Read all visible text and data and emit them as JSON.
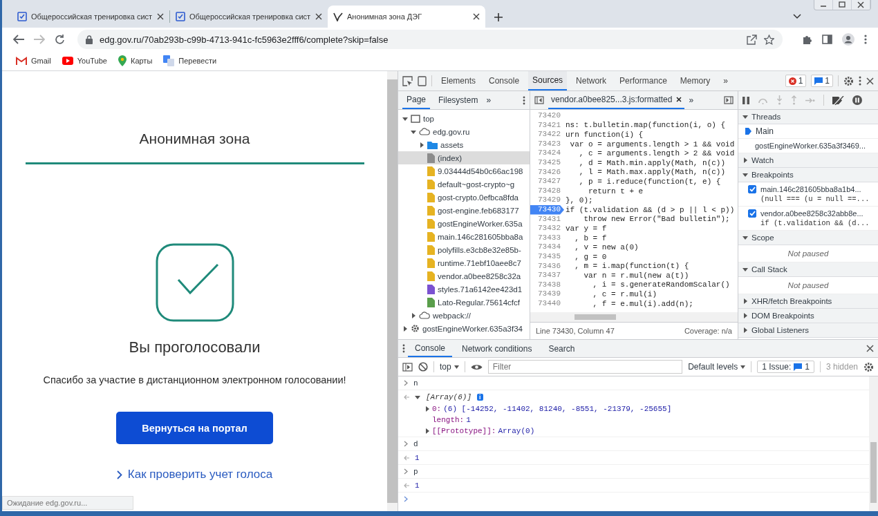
{
  "browser": {
    "tabs": [
      {
        "title": "Общероссийская тренировка сист",
        "kind": "ballot",
        "selected": false
      },
      {
        "title": "Общероссийская тренировка сист",
        "kind": "ballot",
        "selected": false
      },
      {
        "title": "Анонимная зона ДЭГ",
        "kind": "deg",
        "selected": true
      }
    ],
    "address": "edg.gov.ru/70ab293b-c99b-4713-941c-fc5963e2fff6/complete?skip=false",
    "bookmarks": [
      {
        "label": "Gmail",
        "kind": "gmail"
      },
      {
        "label": "YouTube",
        "kind": "youtube"
      },
      {
        "label": "Карты",
        "kind": "maps"
      },
      {
        "label": "Перевести",
        "kind": "translate"
      }
    ]
  },
  "page": {
    "title": "Анонимная зона",
    "heading": "Вы проголосовали",
    "message": "Спасибо за участие в дистанционном электронном голосовании!",
    "button": "Вернуться на портал",
    "link": "Как проверить учет голоса",
    "status": "Ожидание edg.gov.ru..."
  },
  "devtools": {
    "panels": [
      {
        "label": "Elements",
        "selected": false
      },
      {
        "label": "Console",
        "selected": false
      },
      {
        "label": "Sources",
        "selected": true
      },
      {
        "label": "Network",
        "selected": false
      },
      {
        "label": "Performance",
        "selected": false
      },
      {
        "label": "Memory",
        "selected": false
      }
    ],
    "more": "»",
    "errors": "1",
    "messages": "1",
    "navigator": {
      "tabs": [
        {
          "label": "Page",
          "selected": true
        },
        {
          "label": "Filesystem",
          "selected": false
        }
      ],
      "more": "»",
      "tree": [
        {
          "label": "top",
          "kind": "frame",
          "expanded": true,
          "selected": false,
          "children": [
            {
              "label": "edg.gov.ru",
              "kind": "domain",
              "expanded": true,
              "selected": false,
              "children": [
                {
                  "label": "assets",
                  "kind": "folder",
                  "expanded": false,
                  "selected": false
                },
                {
                  "label": "(index)",
                  "kind": "file",
                  "color": "#8c8c8c",
                  "selected": true
                },
                {
                  "label": "9.03444d54b0c66ac198",
                  "kind": "file",
                  "color": "#e6b322",
                  "selected": false
                },
                {
                  "label": "default~gost-crypto~g",
                  "kind": "file",
                  "color": "#e6b322",
                  "selected": false
                },
                {
                  "label": "gost-crypto.0efbca8fda",
                  "kind": "file",
                  "color": "#e6b322",
                  "selected": false
                },
                {
                  "label": "gost-engine.feb683177",
                  "kind": "file",
                  "color": "#e6b322",
                  "selected": false
                },
                {
                  "label": "gostEngineWorker.635a",
                  "kind": "file",
                  "color": "#e6b322",
                  "selected": false
                },
                {
                  "label": "main.146c281605bba8a",
                  "kind": "file",
                  "color": "#e6b322",
                  "selected": false
                },
                {
                  "label": "polyfills.e3cb8e32e85b-",
                  "kind": "file",
                  "color": "#e6b322",
                  "selected": false
                },
                {
                  "label": "runtime.71ebf10aee8c7",
                  "kind": "file",
                  "color": "#e6b322",
                  "selected": false
                },
                {
                  "label": "vendor.a0bee8258c32a",
                  "kind": "file",
                  "color": "#e6b322",
                  "selected": false
                },
                {
                  "label": "styles.71a6142ee423d1",
                  "kind": "file",
                  "color": "#7b52d1",
                  "selected": false
                },
                {
                  "label": "Lato-Regular.75614cfcf",
                  "kind": "file",
                  "color": "#5a9e4b",
                  "selected": false
                }
              ]
            },
            {
              "label": "webpack://",
              "kind": "domain",
              "expanded": false,
              "selected": false
            }
          ]
        },
        {
          "label": "gostEngineWorker.635a3f34",
          "kind": "worker",
          "expanded": false,
          "selected": false
        }
      ]
    },
    "editor": {
      "file": "vendor.a0bee825...3.js:formatted",
      "more": "»",
      "position": "Line 73430, Column 47",
      "coverage": "Coverage: n/a",
      "lines": [
        {
          "number": "73420",
          "breakpoint": false
        },
        {
          "number": "73421",
          "code": "ns: t.bulletin.map(function(i, o) {",
          "breakpoint": false
        },
        {
          "number": "73422",
          "code": "urn function(i) {",
          "breakpoint": false
        },
        {
          "number": "73423",
          "code": " var o = arguments.length > 1 && void",
          "breakpoint": false
        },
        {
          "number": "73424",
          "code": "   , c = arguments.length > 2 && void",
          "breakpoint": false
        },
        {
          "number": "73425",
          "code": "   , d = Math.min.apply(Math, n(c))",
          "breakpoint": false
        },
        {
          "number": "73426",
          "code": "   , l = Math.max.apply(Math, n(c))",
          "breakpoint": false
        },
        {
          "number": "73427",
          "code": "   , p = i.reduce(function(t, e) {",
          "breakpoint": false
        },
        {
          "number": "73428",
          "code": "     return t + e",
          "breakpoint": false
        },
        {
          "number": "73429",
          "code": "}, 0);",
          "breakpoint": false
        },
        {
          "number": "73430",
          "code": "if (t.validation && (d > p || l < p))",
          "breakpoint": true
        },
        {
          "number": "73431",
          "code": "    throw new Error(\"Bad bulletin\");",
          "breakpoint": false
        },
        {
          "number": "73432",
          "code": "var y = f",
          "breakpoint": false
        },
        {
          "number": "73433",
          "code": "  , b = f",
          "breakpoint": false
        },
        {
          "number": "73434",
          "code": "  , v = new a(0)",
          "breakpoint": false
        },
        {
          "number": "73435",
          "code": "  , g = 0",
          "breakpoint": false
        },
        {
          "number": "73436",
          "code": "  , m = i.map(function(t) {",
          "breakpoint": false
        },
        {
          "number": "73437",
          "code": "    var n = r.mul(new a(t))",
          "breakpoint": false
        },
        {
          "number": "73438",
          "code": "      , i = s.generateRandomScalar()",
          "breakpoint": false
        },
        {
          "number": "73439",
          "code": "      , c = r.mul(i)",
          "breakpoint": false
        },
        {
          "number": "73440",
          "code": "      , f = e.mul(i).add(n);",
          "breakpoint": false
        }
      ]
    },
    "sidebar": [
      {
        "title": "Threads",
        "kind": "threads",
        "expanded": true,
        "items": [
          {
            "label": "Main",
            "selected": true
          },
          {
            "label": "gostEngineWorker.635a3f3469...",
            "selected": false
          }
        ]
      },
      {
        "title": "Watch",
        "expanded": false
      },
      {
        "title": "Breakpoints",
        "kind": "breakpoints",
        "expanded": true,
        "items": [
          {
            "file": "main.146c281605bba8a1b4...",
            "code": "(null === (u = null ==...",
            "checked": true
          },
          {
            "file": "vendor.a0bee8258c32abb8e...",
            "code": "if (t.validation && (d...",
            "checked": true
          }
        ]
      },
      {
        "title": "Scope",
        "kind": "note",
        "expanded": true,
        "note": "Not paused"
      },
      {
        "title": "Call Stack",
        "kind": "note",
        "expanded": true,
        "note": "Not paused"
      },
      {
        "title": "XHR/fetch Breakpoints",
        "expanded": false
      },
      {
        "title": "DOM Breakpoints",
        "expanded": false
      },
      {
        "title": "Global Listeners",
        "expanded": false
      }
    ],
    "drawer": {
      "tabs": [
        {
          "label": "Console",
          "selected": true
        },
        {
          "label": "Network conditions",
          "selected": false
        },
        {
          "label": "Search",
          "selected": false
        }
      ],
      "context": "top",
      "filter_placeholder": "Filter",
      "levels": "Default levels",
      "issues_label": "1 Issue:",
      "issues_count": "1",
      "hidden": "3 hidden",
      "entries": [
        {
          "kind": "input",
          "text": "n"
        },
        {
          "kind": "object",
          "text": "[Array(6)]",
          "badge": "i",
          "expanded": true,
          "children": [
            {
              "key": "0:",
              "value": "(6) [-14252, -11402, 81240, -8551, -21379, -25655]",
              "expanded": false
            },
            {
              "key": "length:",
              "value": "1"
            },
            {
              "key": "[[Prototype]]:",
              "value": "Array(0)",
              "expanded": false
            }
          ]
        },
        {
          "kind": "input",
          "text": "d"
        },
        {
          "kind": "result",
          "text": "1"
        },
        {
          "kind": "input",
          "text": "p"
        },
        {
          "kind": "result",
          "text": "1"
        },
        {
          "kind": "prompt"
        }
      ]
    }
  }
}
